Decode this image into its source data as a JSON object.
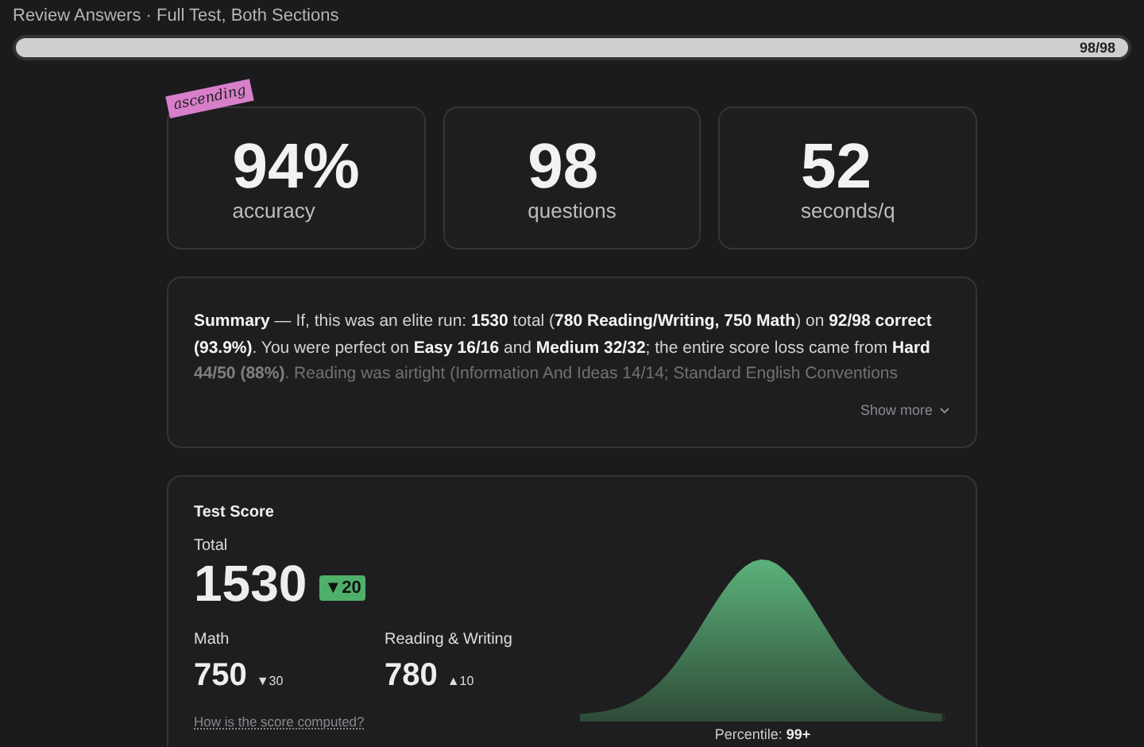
{
  "header": {
    "title": "Review Answers · Full Test, Both Sections",
    "progress": {
      "level": 1,
      "reading": "98/98"
    }
  },
  "stats": [
    {
      "value": "94%",
      "label": "accuracy",
      "sticker": "ascending"
    },
    {
      "value": "98",
      "label": "questions"
    },
    {
      "value": "52",
      "label": "seconds/q"
    }
  ],
  "summary": {
    "text": "**Summary** — If, this was an elite run: **1530** total (**780 Reading/Writing, 750 Math**) on **92/98 correct (93.9%)**. You were perfect on **Easy 16/16** and **Medium 32/32**; the entire score loss came from **Hard 44/50 (88%)**. Reading was airtight (Information And Ideas 14/14; Standard English Conventions",
    "more": "Show more"
  },
  "score": {
    "title": "Test Score",
    "total_label": "Total",
    "total": "1530",
    "total_delta": {
      "arrow": "▼",
      "value": "20"
    },
    "sections": [
      {
        "label": "Math",
        "value": "750",
        "arrow": "▼",
        "delta": "30"
      },
      {
        "label": "Reading & Writing",
        "value": "780",
        "arrow": "▲",
        "delta": "10"
      }
    ],
    "link": "How is the score computed?",
    "percentile_label": "Percentile:",
    "percentile": "99+",
    "curve": {
      "level": 0.99
    }
  }
}
